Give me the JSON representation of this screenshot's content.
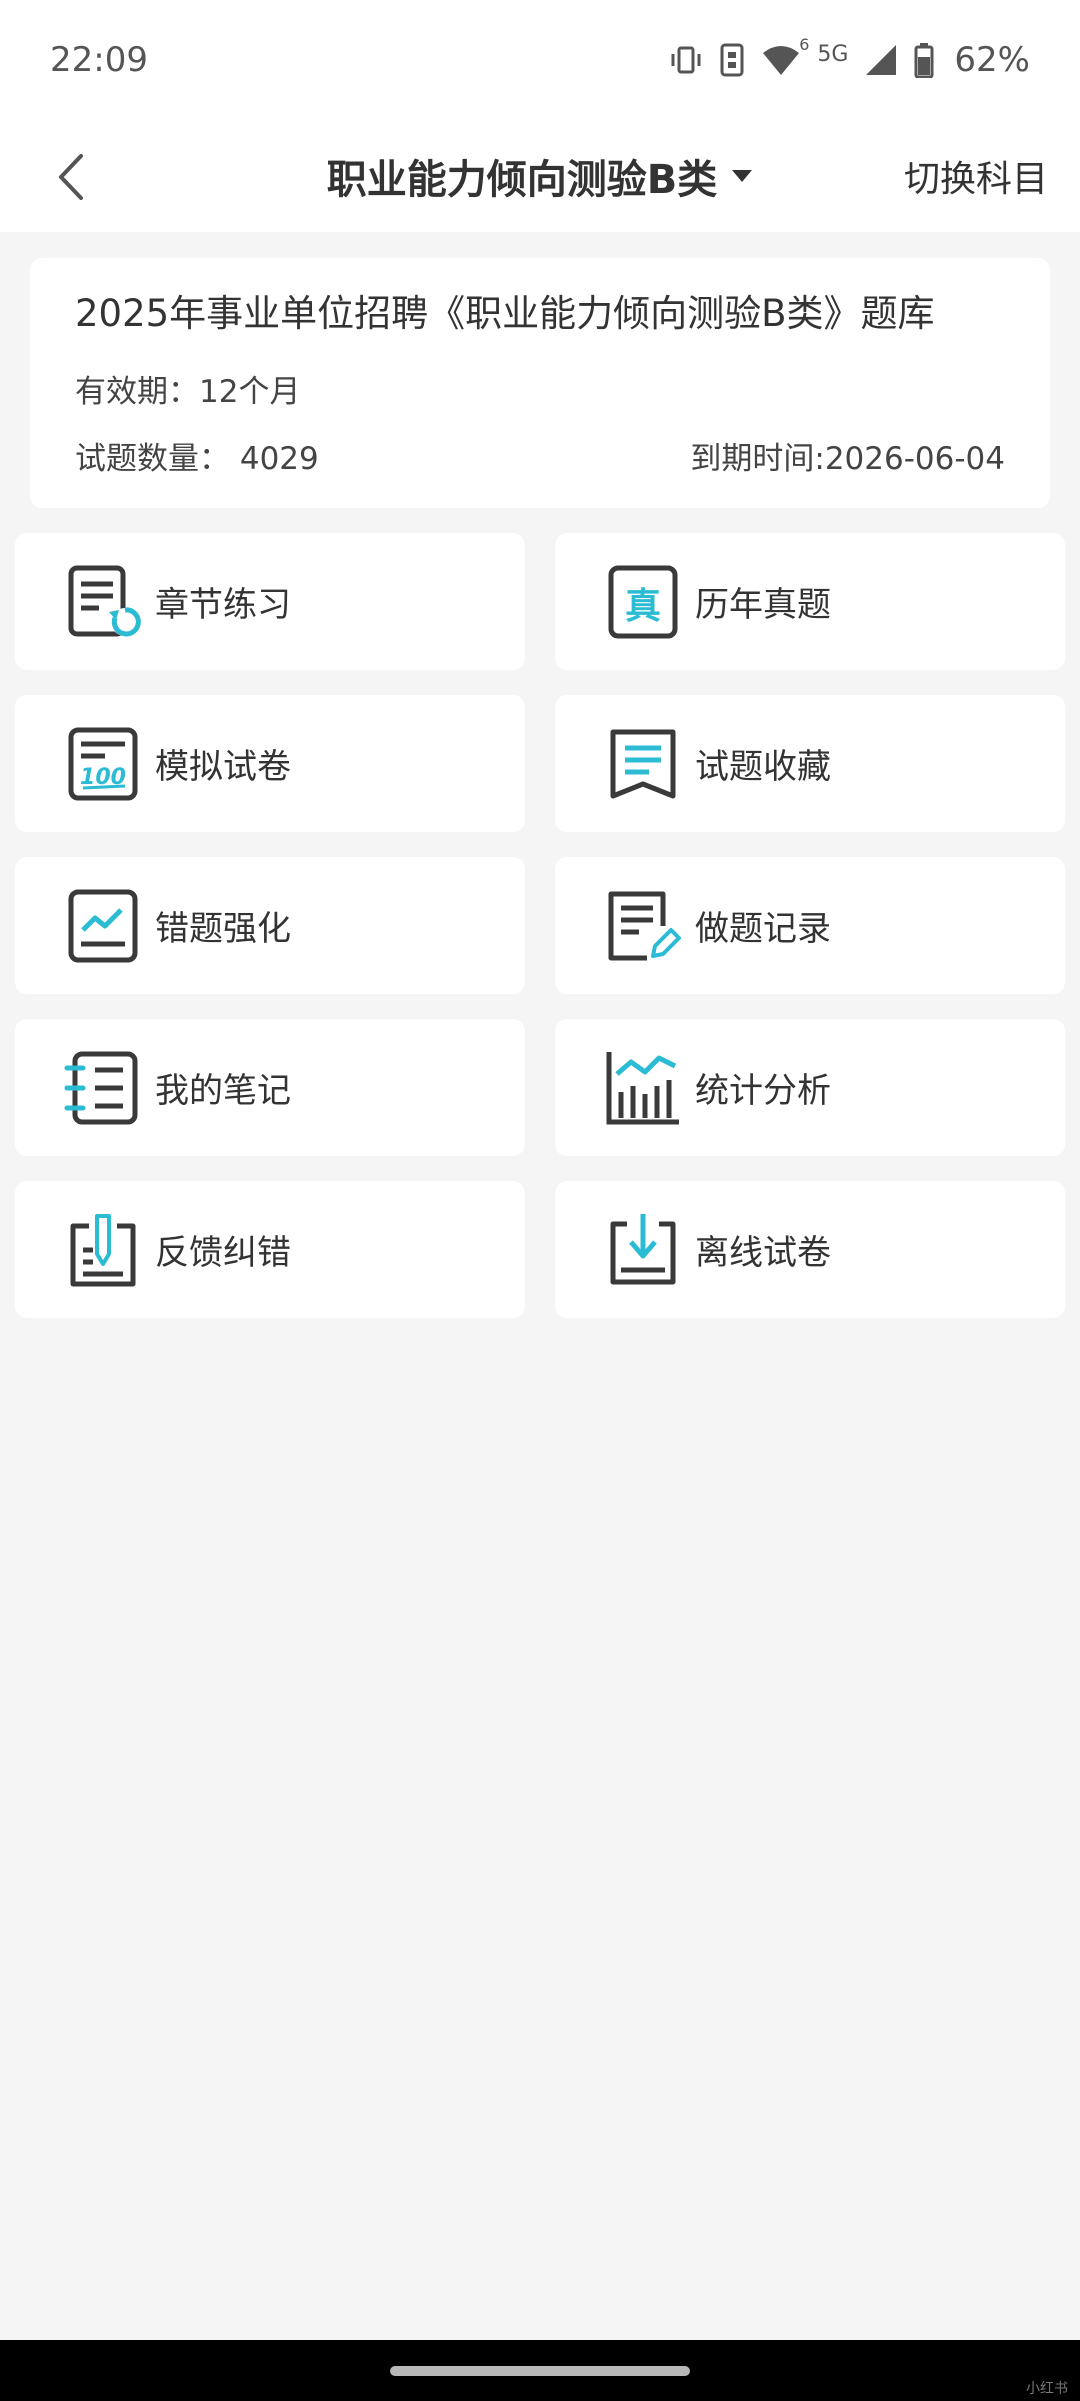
{
  "status_bar": {
    "time": "22:09",
    "battery": "62%",
    "network": "5G",
    "wifi_badge": "6",
    "icons": [
      "vibrate-icon",
      "sim-icon",
      "wifi-icon",
      "signal-icon",
      "battery-icon"
    ]
  },
  "nav": {
    "title": "职业能力倾向测验B类",
    "switch_label": "切换科目"
  },
  "info": {
    "title": "2025年事业单位招聘《职业能力倾向测验B类》题库",
    "validity_label": "有效期：",
    "validity_value": "12个月",
    "count_label": "试题数量：",
    "count_value": "4029",
    "expiry_label": "到期时间:",
    "expiry_value": "2026-06-04"
  },
  "tiles": [
    {
      "label": "章节练习",
      "icon": "chapter-practice-icon"
    },
    {
      "label": "历年真题",
      "icon": "past-exams-icon"
    },
    {
      "label": "模拟试卷",
      "icon": "mock-exam-icon"
    },
    {
      "label": "试题收藏",
      "icon": "favorites-icon"
    },
    {
      "label": "错题强化",
      "icon": "wrong-questions-icon"
    },
    {
      "label": "做题记录",
      "icon": "practice-record-icon"
    },
    {
      "label": "我的笔记",
      "icon": "notes-icon"
    },
    {
      "label": "统计分析",
      "icon": "statistics-icon"
    },
    {
      "label": "反馈纠错",
      "icon": "feedback-icon"
    },
    {
      "label": "离线试卷",
      "icon": "offline-exam-icon"
    }
  ],
  "colors": {
    "accent": "#2bbcd4",
    "icon_dark": "#3a3a3a",
    "background": "#f5f5f5"
  },
  "watermark": "小红书"
}
